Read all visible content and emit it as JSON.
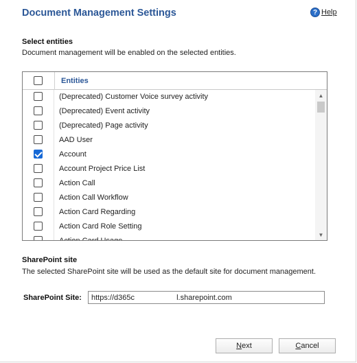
{
  "dialog": {
    "title": "Document Management Settings",
    "help": {
      "icon": "help-icon",
      "label": "Help"
    }
  },
  "entities_section": {
    "title": "Select entities",
    "description": "Document management will be enabled on the selected entities.",
    "column_header": "Entities",
    "items": [
      {
        "label": "(Deprecated) Customer Voice survey activity",
        "checked": false
      },
      {
        "label": "(Deprecated) Event activity",
        "checked": false
      },
      {
        "label": "(Deprecated) Page activity",
        "checked": false
      },
      {
        "label": "AAD User",
        "checked": false
      },
      {
        "label": "Account",
        "checked": true
      },
      {
        "label": "Account Project Price List",
        "checked": false
      },
      {
        "label": "Action Call",
        "checked": false
      },
      {
        "label": "Action Call Workflow",
        "checked": false
      },
      {
        "label": "Action Card Regarding",
        "checked": false
      },
      {
        "label": "Action Card Role Setting",
        "checked": false
      },
      {
        "label": "Action Card Usage",
        "checked": false
      }
    ]
  },
  "sharepoint_section": {
    "title": "SharePoint site",
    "description": "The selected SharePoint site will be used as the default site for document management.",
    "site_label": "SharePoint Site:",
    "site_value": "https://d365c                    l.sharepoint.com"
  },
  "buttons": {
    "next": {
      "accel": "N",
      "rest": "ext"
    },
    "cancel": {
      "accel": "C",
      "rest": "ancel"
    }
  }
}
